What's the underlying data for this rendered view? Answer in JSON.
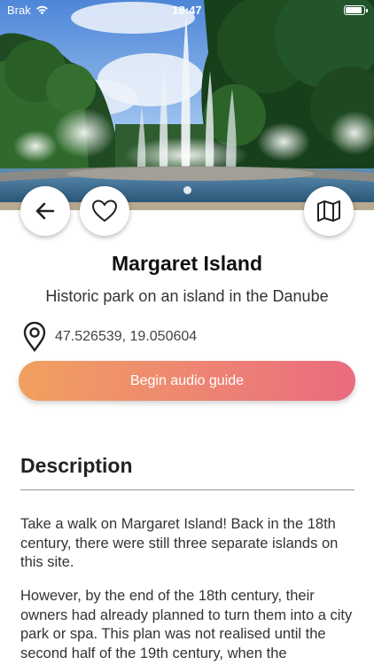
{
  "status_bar": {
    "carrier": "Brak",
    "time": "18:47"
  },
  "hero": {
    "pages_total": 1,
    "active_page": 1
  },
  "place": {
    "title": "Margaret Island",
    "subtitle": "Historic park on an island in the Danube",
    "coordinates": "47.526539, 19.050604"
  },
  "actions": {
    "audio_label": "Begin audio guide"
  },
  "description": {
    "heading": "Description",
    "paragraphs": [
      "Take a walk on Margaret Island! Back in the 18th century, there were still three separate islands on this site.",
      "However, by the end of the 18th century, their owners had already planned to turn them into a city park or spa. This plan was not realised until the second half of the 19th century, when the"
    ]
  },
  "colors": {
    "button_gradient_start": "#f0a060",
    "button_gradient_end": "#ea6b7f"
  }
}
